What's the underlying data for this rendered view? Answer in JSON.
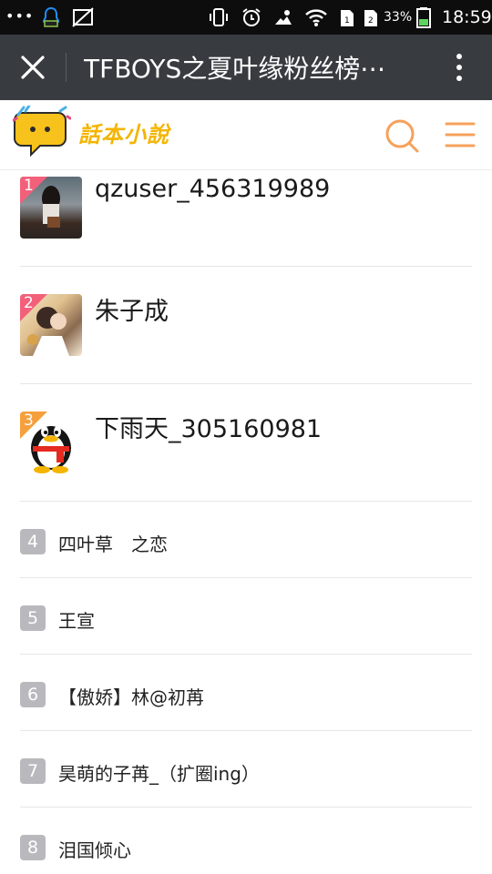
{
  "status_bar": {
    "battery_percent": "33%",
    "time": "18:59",
    "icons": [
      "more-dots-icon",
      "qq-icon",
      "no-image-icon",
      "vibrate-icon",
      "alarm-icon",
      "cloud-icon",
      "wifi-icon",
      "sim1-icon",
      "sim2-icon",
      "battery-icon"
    ]
  },
  "titlebar": {
    "title": "TFBOYS之夏叶缘粉丝榜⋯"
  },
  "header": {
    "logo_text": "話本小說"
  },
  "top_list": [
    {
      "rank": "1",
      "name": "qzuser_456319989",
      "corner_color": "#f2607a"
    },
    {
      "rank": "2",
      "name": "朱子成",
      "corner_color": "#f2607a"
    },
    {
      "rank": "3",
      "name": "下雨天_305160981",
      "corner_color": "#f5a03c"
    }
  ],
  "list": [
    {
      "rank": "4",
      "name": "四叶草　之恋"
    },
    {
      "rank": "5",
      "name": "王宣"
    },
    {
      "rank": "6",
      "name": "【傲娇】林@初苒"
    },
    {
      "rank": "7",
      "name": "昊萌的子苒_（扩圈ing）"
    },
    {
      "rank": "8",
      "name": "泪国倾心"
    }
  ],
  "colors": {
    "titlebar_bg": "#383c40",
    "accent_orange": "#f6a15a",
    "badge_gray": "#b9b9bd"
  }
}
